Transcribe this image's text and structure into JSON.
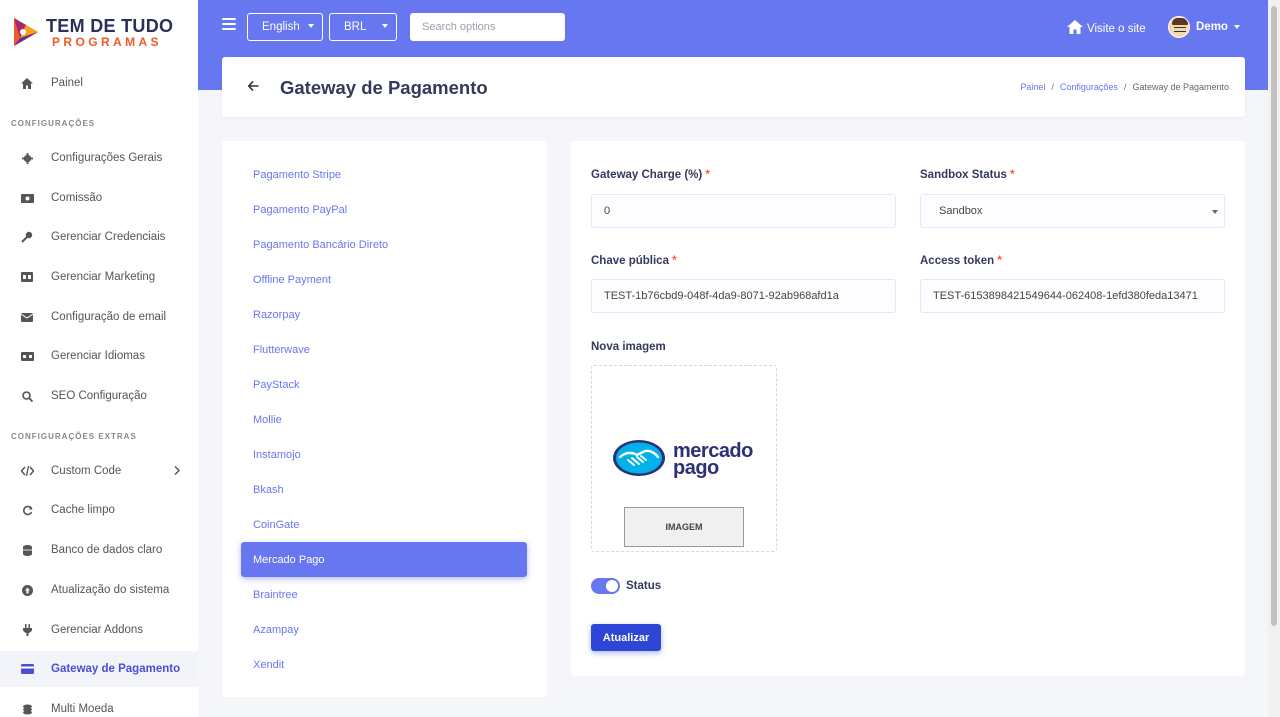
{
  "brand": {
    "line1": "TEM DE TUDO",
    "line2": "PROGRAMAS"
  },
  "sidebar": {
    "section_config": "CONFIGURAÇÕES",
    "section_extra": "CONFIGURAÇÕES EXTRAS",
    "items": [
      {
        "label": "Painel",
        "icon": "home-icon"
      },
      {
        "label": "Configurações Gerais",
        "icon": "gear-icon"
      },
      {
        "label": "Comissão",
        "icon": "money-icon"
      },
      {
        "label": "Gerenciar Credenciais",
        "icon": "key-icon"
      },
      {
        "label": "Gerenciar Marketing",
        "icon": "ad-icon"
      },
      {
        "label": "Configuração de email",
        "icon": "envelope-icon"
      },
      {
        "label": "Gerenciar Idiomas",
        "icon": "language-icon"
      },
      {
        "label": "SEO Configuração",
        "icon": "search-icon"
      },
      {
        "label": "Custom Code",
        "icon": "code-icon"
      },
      {
        "label": "Cache limpo",
        "icon": "refresh-icon"
      },
      {
        "label": "Banco de dados claro",
        "icon": "database-icon"
      },
      {
        "label": "Atualização do sistema",
        "icon": "upload-icon"
      },
      {
        "label": "Gerenciar Addons",
        "icon": "plug-icon"
      },
      {
        "label": "Gateway de Pagamento",
        "icon": "credit-card-icon"
      },
      {
        "label": "Multi Moeda",
        "icon": "coins-icon"
      }
    ]
  },
  "header": {
    "language": "English",
    "currency": "BRL",
    "search_placeholder": "Search options",
    "visit_site": "Visite o site",
    "user_name": "Demo"
  },
  "page": {
    "title": "Gateway de Pagamento",
    "breadcrumb": [
      "Painel",
      "Configurações",
      "Gateway de Pagamento"
    ],
    "breadcrumb_sep": "/"
  },
  "gateways": [
    "Pagamento Stripe",
    "Pagamento PayPal",
    "Pagamento Bancário Direto",
    "Offline Payment",
    "Razorpay",
    "Flutterwave",
    "PayStack",
    "Mollie",
    "Instamojo",
    "Bkash",
    "CoinGate",
    "Mercado Pago",
    "Braintree",
    "Azampay",
    "Xendit"
  ],
  "active_gateway": "Mercado Pago",
  "form": {
    "charge_label": "Gateway Charge (%)",
    "charge_value": "0",
    "sandbox_label": "Sandbox Status",
    "sandbox_value": "Sandbox",
    "public_key_label": "Chave pública",
    "public_key_value": "TEST-1b76cbd9-048f-4da9-8071-92ab968afd1a",
    "access_token_label": "Access token",
    "access_token_value": "TEST-6153898421549644-062408-1efd380feda13471",
    "image_label": "Nova imagem",
    "logo_line1": "mercado",
    "logo_line2": "pago",
    "image_button": "IMAGEM",
    "status_label": "Status",
    "status_on": true,
    "submit": "Atualizar",
    "required_mark": "*"
  },
  "colors": {
    "primary": "#6777ef",
    "button": "#2e46d6",
    "required": "#fc544b"
  }
}
